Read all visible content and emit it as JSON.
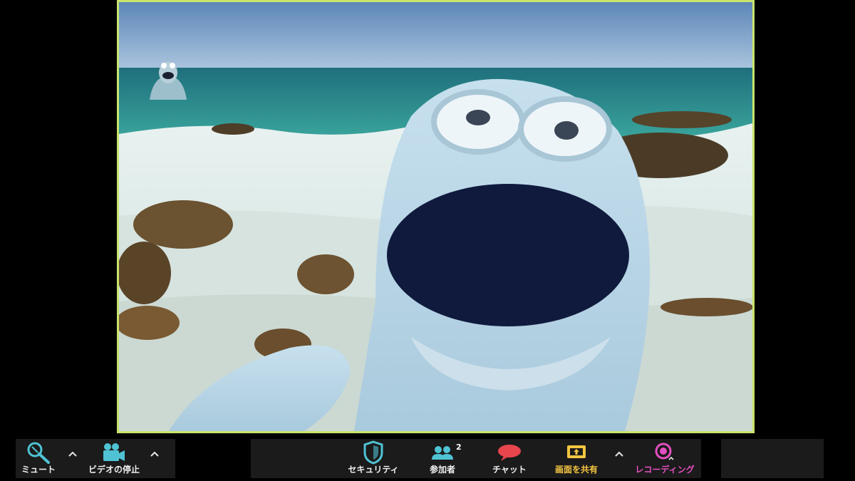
{
  "window": {
    "accent_border": "#c8e46c",
    "toolbar_bg": "#1b1b1b"
  },
  "video": {
    "scene": "beach-virtual-background",
    "speaker_avatar": "blue-monster-puppet",
    "self_view_avatar": "gray-monster-puppet"
  },
  "toolbar": {
    "mute": {
      "label": "ミュート",
      "icon": "microphone-icon",
      "color": "#4fc3d4"
    },
    "video": {
      "label": "ビデオの停止",
      "icon": "video-camera-icon",
      "color": "#4fc3d4"
    },
    "security": {
      "label": "セキュリティ",
      "icon": "shield-icon",
      "color": "#4fc3d4"
    },
    "participants": {
      "label": "参加者",
      "count": "2",
      "icon": "people-icon",
      "color": "#4fc3d4"
    },
    "chat": {
      "label": "チャット",
      "icon": "chat-bubble-icon",
      "color": "#e8454d"
    },
    "share": {
      "label": "画面を共有",
      "icon": "share-screen-icon",
      "color": "#f5c542"
    },
    "record": {
      "label": "レコーディング",
      "icon": "record-icon",
      "color": "#e44fc0"
    }
  }
}
